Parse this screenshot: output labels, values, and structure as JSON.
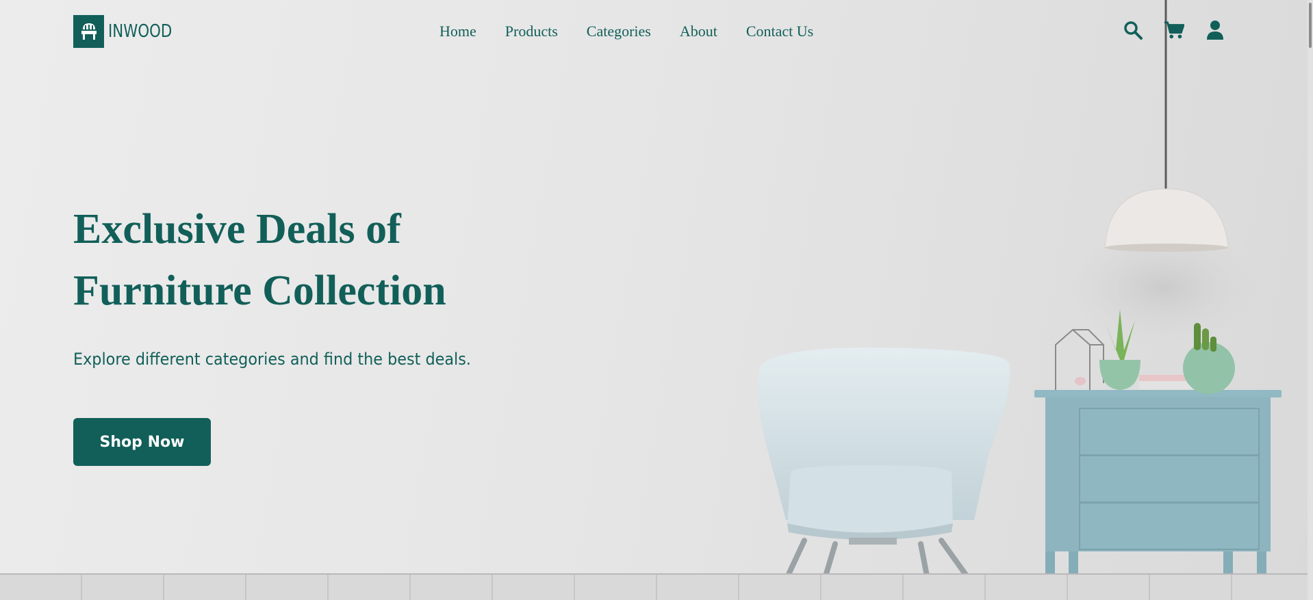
{
  "brand": {
    "name": "INWOOD",
    "logo_icon": "chair-icon"
  },
  "nav": {
    "links": [
      {
        "label": "Home"
      },
      {
        "label": "Products"
      },
      {
        "label": "Categories"
      },
      {
        "label": "About"
      },
      {
        "label": "Contact Us"
      }
    ],
    "icons": [
      "search-icon",
      "cart-icon",
      "user-icon"
    ]
  },
  "hero": {
    "title_line1": "Exclusive Deals of",
    "title_line2": "Furniture Collection",
    "subtitle": "Explore different categories and find the best deals.",
    "cta_label": "Shop Now"
  },
  "colors": {
    "primary": "#125f59",
    "background": "#e6e6e6",
    "accent_furniture": "#8db4bf"
  }
}
